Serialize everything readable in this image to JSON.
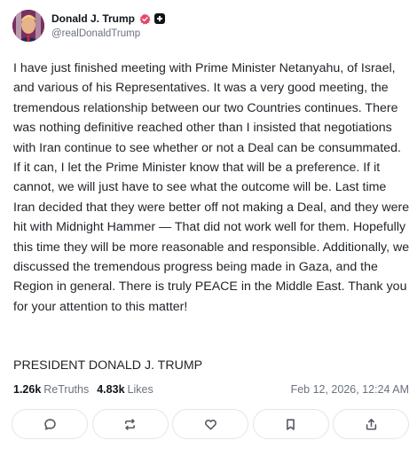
{
  "author": {
    "display_name": "Donald J. Trump",
    "handle": "@realDonaldTrump",
    "verified_icon": "verified-badge-icon",
    "plus_icon": "plus-badge-icon",
    "verified_color": "#e5466b"
  },
  "post": {
    "body": "I have just finished meeting with Prime Minister Netanyahu, of Israel, and various of his Representatives. It was a very good meeting, the tremendous relationship between our two Countries continues. There was nothing definitive reached other than I insisted that negotiations with Iran continue to see whether or not a Deal can be consummated. If it can, I let the Prime Minister know that will be a preference. If it cannot, we will just have to see what the outcome will be. Last time Iran decided that they were better off not making a Deal, and they were hit with Midnight Hammer — That did not work well for them. Hopefully this time they will be more reasonable and responsible. Additionally, we discussed the tremendous progress being made in Gaza, and the Region in general. There is truly PEACE in the Middle East. Thank you for your attention to this matter!",
    "signature": "PRESIDENT DONALD J. TRUMP"
  },
  "stats": {
    "retruths_count": "1.26k",
    "retruths_label": "ReTruths",
    "likes_count": "4.83k",
    "likes_label": "Likes",
    "timestamp": "Feb 12, 2026, 12:24 AM"
  },
  "actions": [
    {
      "icon": "reply-icon"
    },
    {
      "icon": "retruth-icon"
    },
    {
      "icon": "like-icon"
    },
    {
      "icon": "bookmark-icon"
    },
    {
      "icon": "share-icon"
    }
  ]
}
